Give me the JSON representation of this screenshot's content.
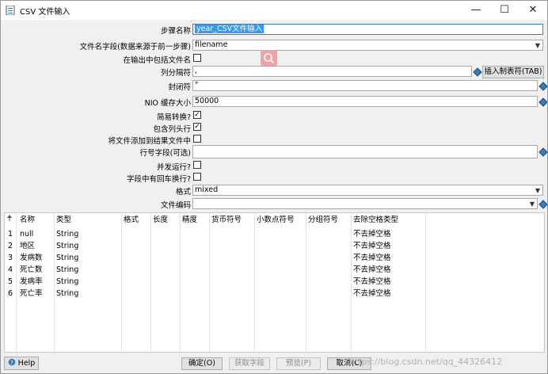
{
  "window": {
    "title": "CSV 文件输入",
    "minimize": "—",
    "maximize": "☐",
    "close": "✕"
  },
  "form": {
    "step_name": {
      "label": "步骤名称",
      "value": "year_CSV文件输入"
    },
    "filename_field": {
      "label": "文件名字段(数据来源于前一步骤)",
      "value": "filename"
    },
    "include_filename": {
      "label": "在输出中包括文件名",
      "checked": false
    },
    "delimiter": {
      "label": "列分隔符",
      "value": ",",
      "button": "插入制表符(TAB)"
    },
    "enclosure": {
      "label": "封闭符",
      "value": "\""
    },
    "nio_buffer": {
      "label": "NIO 缓存大小",
      "value": "50000"
    },
    "lazy_conversion": {
      "label": "简易转换?",
      "checked": true
    },
    "header_row": {
      "label": "包含列头行",
      "checked": true
    },
    "add_to_result": {
      "label": "将文件添加到结果文件中",
      "checked": false
    },
    "row_number_field": {
      "label": "行号字段(可选)",
      "value": ""
    },
    "parallel": {
      "label": "并发运行?",
      "checked": false
    },
    "newline_in_field": {
      "label": "字段中有回车换行?",
      "checked": false
    },
    "format": {
      "label": "格式",
      "value": "mixed"
    },
    "encoding": {
      "label": "文件编码",
      "value": ""
    }
  },
  "table": {
    "columns": [
      "名称",
      "类型",
      "格式",
      "长度",
      "精度",
      "货币符号",
      "小数点符号",
      "分组符号",
      "去除空格类型"
    ],
    "rows": [
      {
        "num": "1",
        "name": "null",
        "type": "String",
        "trim": "不去掉空格"
      },
      {
        "num": "2",
        "name": "地区",
        "type": "String",
        "trim": "不去掉空格"
      },
      {
        "num": "3",
        "name": "发病数",
        "type": "String",
        "trim": "不去掉空格"
      },
      {
        "num": "4",
        "name": "死亡数",
        "type": "String",
        "trim": "不去掉空格"
      },
      {
        "num": "5",
        "name": "发病率",
        "type": "String",
        "trim": "不去掉空格"
      },
      {
        "num": "6",
        "name": "死亡率",
        "type": "String",
        "trim": "不去掉空格"
      }
    ]
  },
  "buttons": {
    "help": "Help",
    "ok": "确定(O)",
    "get_fields": "获取字段",
    "preview": "预览(P)",
    "cancel": "取消(C)"
  },
  "watermark": "https://blog.csdn.net/qq_44326412",
  "colors": {
    "selection": "#3399ff",
    "var_diamond": "#2f7fc0",
    "search_badge": "#f4a3a3"
  }
}
